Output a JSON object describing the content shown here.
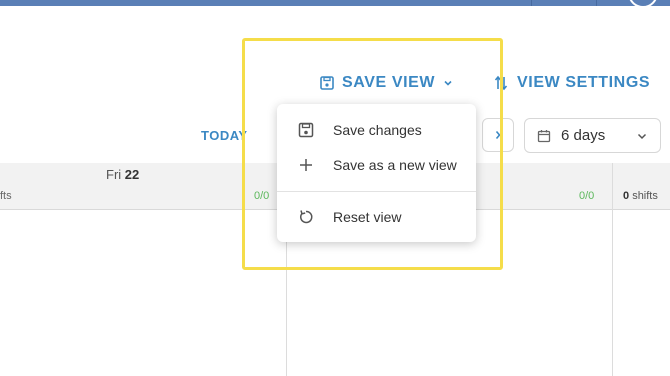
{
  "toolbar": {
    "save_view_label": "SAVE VIEW",
    "view_settings_label": "VIEW SETTINGS",
    "today_label": "TODAY",
    "days_value": "6 days"
  },
  "grid": {
    "day_name": "Fri",
    "day_number": "22",
    "left_shifts_partial": "fts",
    "counts": [
      "0/0",
      "0/0"
    ],
    "right_shifts_count": "0",
    "right_shifts_word": "shifts"
  },
  "save_menu": {
    "items": [
      {
        "label": "Save changes",
        "icon": "save-icon"
      },
      {
        "label": "Save as a new view",
        "icon": "plus-icon"
      },
      {
        "label": "Reset view",
        "icon": "reset-icon"
      }
    ]
  },
  "colors": {
    "accent": "#3b88c3",
    "topbar": "#5a7fb6",
    "highlight": "#f5dd4a",
    "count_green": "#5cb85c"
  }
}
